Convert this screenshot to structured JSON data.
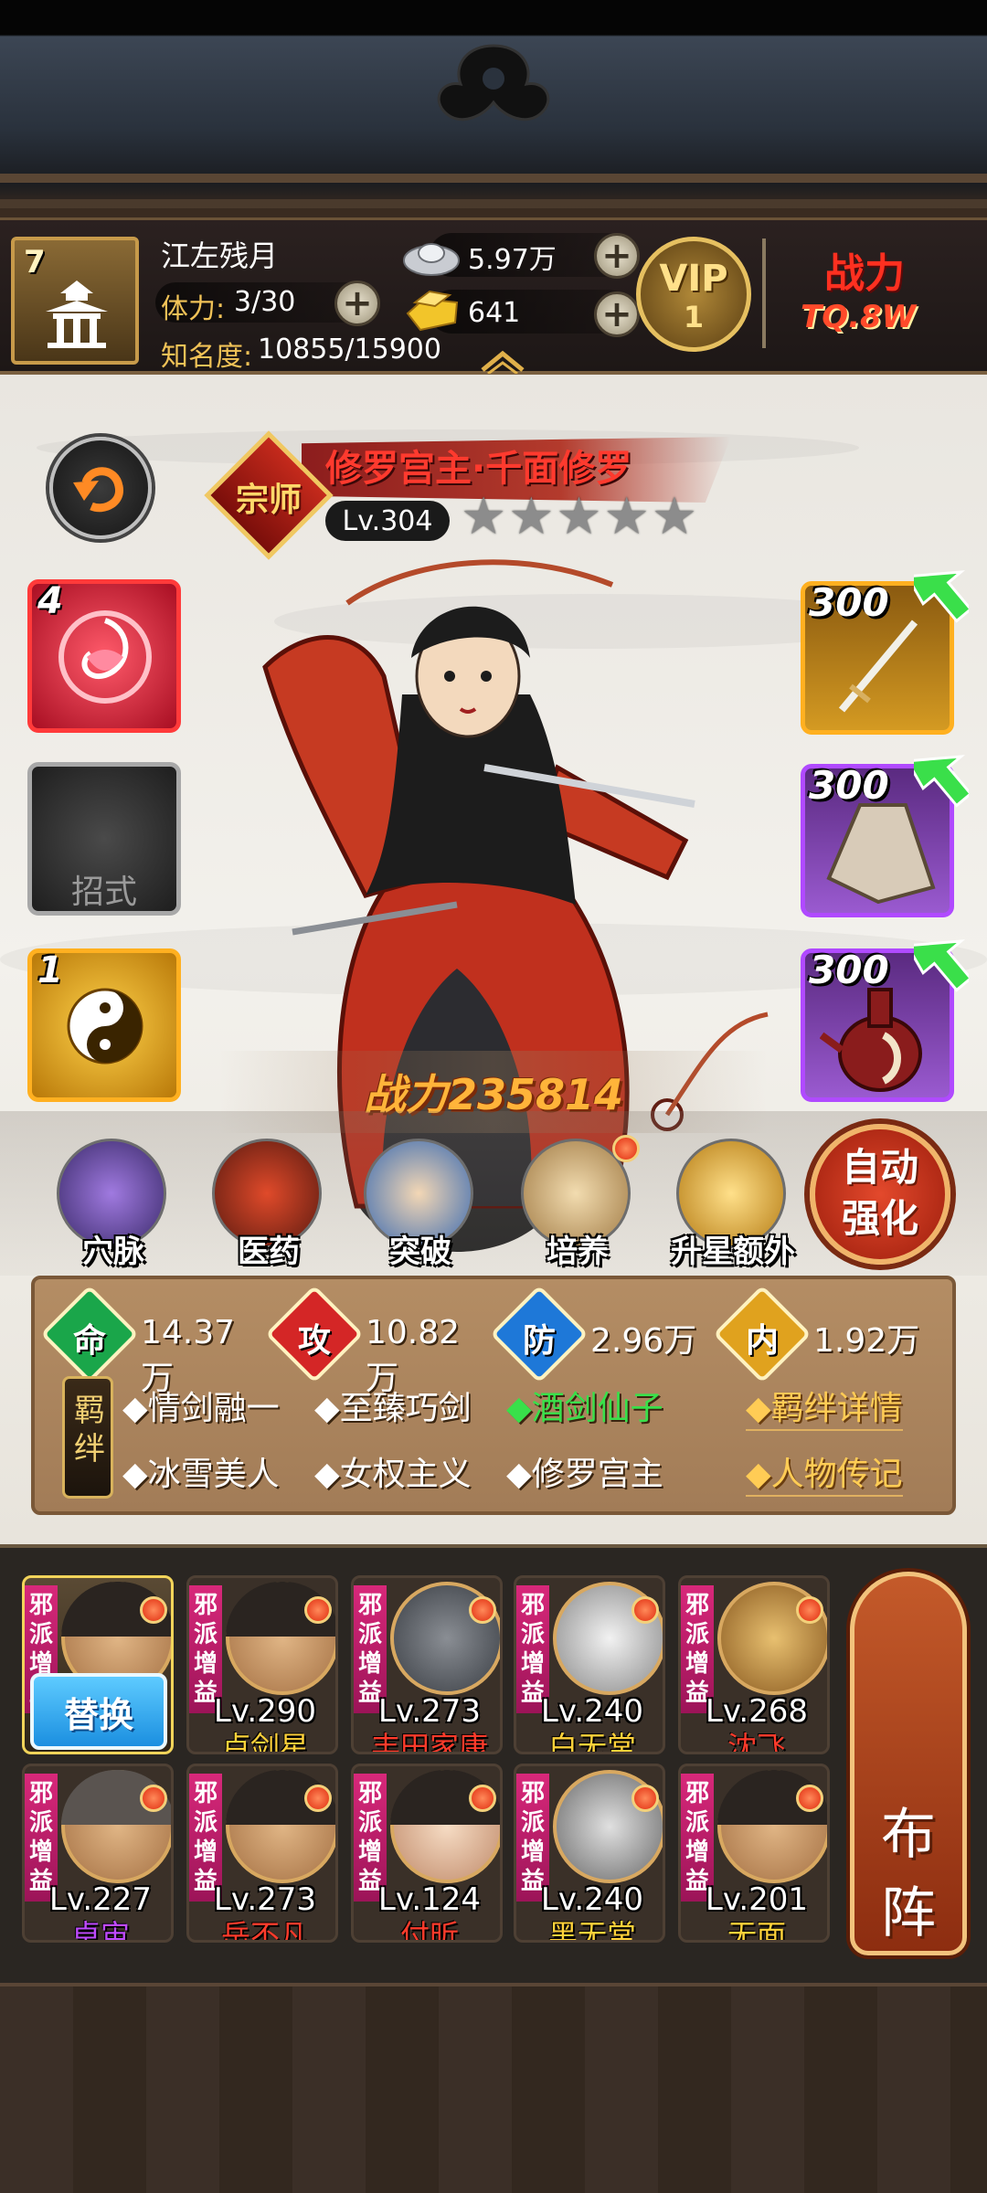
{
  "header": {
    "player_level": "7",
    "player_name": "江左残月",
    "stamina_label": "体力:",
    "stamina_value": "3/30",
    "fame_label": "知名度:",
    "fame_value": "10855/15900",
    "silver": "5.97万",
    "gold": "641",
    "vip_label": "VIP",
    "vip_level": "1",
    "power_label": "战力",
    "power_value": "TQ.8W"
  },
  "hero": {
    "rank_badge": "宗师",
    "name": "修罗宫主·千面修罗",
    "level": "Lv.304",
    "stars_total": 5,
    "stars_filled": 0,
    "power_text": "战力235814"
  },
  "left_slots": [
    {
      "count": "4",
      "label": ""
    },
    {
      "count": "",
      "label": "招式"
    },
    {
      "count": "1",
      "label": ""
    }
  ],
  "equipment": [
    {
      "level": "300",
      "item": "sword"
    },
    {
      "level": "300",
      "item": "cloak"
    },
    {
      "level": "300",
      "item": "jug"
    }
  ],
  "menu": [
    {
      "label": "穴脉",
      "icon": "meridian-icon",
      "dot": false
    },
    {
      "label": "医药",
      "icon": "medicine-icon",
      "dot": false
    },
    {
      "label": "突破",
      "icon": "breakthrough-icon",
      "dot": false
    },
    {
      "label": "培养",
      "icon": "training-icon",
      "dot": true
    },
    {
      "label": "升星额外",
      "icon": "star-up-icon",
      "dot": false
    }
  ],
  "auto_button": {
    "line1": "自动",
    "line2": "强化"
  },
  "stats": [
    {
      "gem": "命",
      "value": "14.37万",
      "color": "#1aa64a"
    },
    {
      "gem": "攻",
      "value": "10.82万",
      "color": "#d42626"
    },
    {
      "gem": "防",
      "value": "2.96万",
      "color": "#1e78d8"
    },
    {
      "gem": "内",
      "value": "1.92万",
      "color": "#e0a21e"
    }
  ],
  "bonds": {
    "tag": "羁绊",
    "row1": [
      "◆情剑融一",
      "◆至臻巧剑",
      "◆酒剑仙子"
    ],
    "row2": [
      "◆冰雪美人",
      "◆女权主义",
      "◆修罗宫主"
    ],
    "active_color": "#38e04a",
    "link_details": "◆羁绊详情",
    "link_bio": "◆人物传记"
  },
  "team": {
    "swap_label": "替换",
    "formation_label": "布阵",
    "tag_text": "邪派增益",
    "members": [
      {
        "level": "",
        "name": "",
        "color": "#ffffff"
      },
      {
        "level": "Lv.290",
        "name": "卢剑星",
        "color": "#ffd23a"
      },
      {
        "level": "Lv.273",
        "name": "丰田家康",
        "color": "#ff3b2b"
      },
      {
        "level": "Lv.240",
        "name": "白无常",
        "color": "#ffd23a"
      },
      {
        "level": "Lv.268",
        "name": "沈飞",
        "color": "#ff3b2b"
      },
      {
        "level": "Lv.227",
        "name": "卓宙",
        "color": "#c04aff"
      },
      {
        "level": "Lv.273",
        "name": "岳不凡",
        "color": "#ff3b2b"
      },
      {
        "level": "Lv.124",
        "name": "付昕",
        "color": "#ff3b2b"
      },
      {
        "level": "Lv.240",
        "name": "黑无常",
        "color": "#ffd23a"
      },
      {
        "level": "Lv.201",
        "name": "无面",
        "color": "#ffd23a"
      }
    ]
  }
}
